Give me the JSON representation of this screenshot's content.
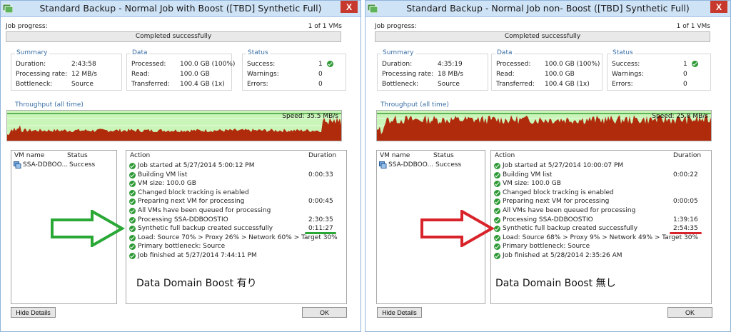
{
  "colors": {
    "green_accent": "#2aa836",
    "red_accent": "#d9232a",
    "throughput_bar": "#b02a0c",
    "throughput_bg": "#c9f5b8",
    "success_icon": "#2e9a36",
    "titlebar": "#cfe3f7",
    "close_button": "#c7392c"
  },
  "labels": {
    "job_progress": "Job progress:",
    "summary": "Summary",
    "duration": "Duration:",
    "processing_rate": "Processing rate:",
    "bottleneck": "Bottleneck:",
    "data": "Data",
    "processed": "Processed:",
    "read": "Read:",
    "transferred": "Transferred:",
    "status": "Status",
    "success": "Success:",
    "warnings": "Warnings:",
    "errors": "Errors:",
    "throughput": "Throughput (all time)",
    "vm_name": "VM name",
    "status_col": "Status",
    "action_col": "Action",
    "duration_col": "Duration",
    "hide_details": "Hide Details",
    "ok": "OK",
    "close": "X"
  },
  "windows": [
    {
      "title": "Standard Backup - Normal Job with Boost ([TBD] Synthetic Full)",
      "vm_count": "1 of 1 VMs",
      "progress_text": "Completed successfully",
      "progress": 1.0,
      "summary": {
        "duration": "2:43:58",
        "rate": "12 MB/s",
        "bottleneck": "Source"
      },
      "data": {
        "processed": "100.0 GB (100%)",
        "read": "100.0 GB",
        "transferred": "100.4 GB (1x)"
      },
      "status": {
        "success": "1",
        "warnings": "0",
        "errors": "0"
      },
      "speed": "Speed: 35.5 MB/s",
      "vms": [
        {
          "name": "SSA-DDBOO...",
          "status": "Success"
        }
      ],
      "actions": [
        {
          "text": "Job started at 5/27/2014 5:00:12 PM",
          "duration": ""
        },
        {
          "text": "Building VM list",
          "duration": "0:00:33"
        },
        {
          "text": "VM size: 100.0 GB",
          "duration": ""
        },
        {
          "text": "Changed block tracking is enabled",
          "duration": ""
        },
        {
          "text": "Preparing next VM for processing",
          "duration": "0:00:45"
        },
        {
          "text": "All VMs have been queued for processing",
          "duration": ""
        },
        {
          "text": "Processing SSA-DDBOOSTIO",
          "duration": "2:30:35"
        },
        {
          "text": "Synthetic full backup created successfully",
          "duration": "0:11:27"
        },
        {
          "text": "Load: Source 70% > Proxy 26% > Network 60% > Target 30%",
          "duration": ""
        },
        {
          "text": "Primary bottleneck: Source",
          "duration": ""
        },
        {
          "text": "Job finished at 5/27/2014 7:44:11 PM",
          "duration": ""
        }
      ],
      "note": "Data Domain Boost 有り"
    },
    {
      "title": "Standard Backup - Normal Job non- Boost ([TBD] Synthetic Full)",
      "vm_count": "1 of 1 VMs",
      "progress_text": "Completed successfully",
      "progress": 1.0,
      "summary": {
        "duration": "4:35:19",
        "rate": "18 MB/s",
        "bottleneck": "Source"
      },
      "data": {
        "processed": "100.0 GB (100%)",
        "read": "100.0 GB",
        "transferred": "100.4 GB (1x)"
      },
      "status": {
        "success": "1",
        "warnings": "0",
        "errors": "0"
      },
      "speed": "Speed: 25.8 MB/s",
      "vms": [
        {
          "name": "SSA-DDBOO...",
          "status": "Success"
        }
      ],
      "actions": [
        {
          "text": "Job started at 5/27/2014 10:00:07 PM",
          "duration": ""
        },
        {
          "text": "Building VM list",
          "duration": "0:00:22"
        },
        {
          "text": "VM size: 100.0 GB",
          "duration": ""
        },
        {
          "text": "Changed block tracking is enabled",
          "duration": ""
        },
        {
          "text": "Preparing next VM for processing",
          "duration": "0:00:05"
        },
        {
          "text": "All VMs have been queued for processing",
          "duration": ""
        },
        {
          "text": "Processing SSA-DDBOOSTIO",
          "duration": "1:39:16"
        },
        {
          "text": "Synthetic full backup created successfully",
          "duration": "2:54:35"
        },
        {
          "text": "Load: Source 68% > Proxy 9% > Network 49% > Target 30%",
          "duration": ""
        },
        {
          "text": "Primary bottleneck: Source",
          "duration": ""
        },
        {
          "text": "Job finished at 5/28/2014 2:35:26 AM",
          "duration": ""
        }
      ],
      "note": "Data Domain Boost 無し"
    }
  ]
}
